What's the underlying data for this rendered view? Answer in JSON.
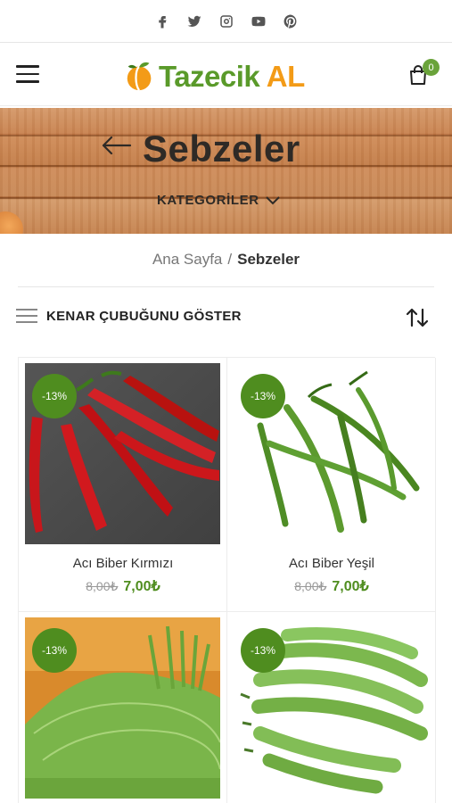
{
  "social": {
    "icons": [
      "facebook-icon",
      "twitter-icon",
      "instagram-icon",
      "youtube-icon",
      "pinterest-icon"
    ]
  },
  "header": {
    "logo_text_main": "Tazecik",
    "logo_text_accent": "AL",
    "cart_count": "0",
    "brand_green": "#5a9a2a",
    "brand_orange": "#f39b17"
  },
  "hero": {
    "title": "Sebzeler",
    "categories_label": "KATEGORİLER"
  },
  "breadcrumb": {
    "home": "Ana Sayfa",
    "separator": "/",
    "current": "Sebzeler"
  },
  "toolbar": {
    "sidebar_label": "KENAR ÇUBUĞUNU GÖSTER"
  },
  "products": [
    {
      "name": "Acı Biber Kırmızı",
      "old_price": "8,00₺",
      "price": "7,00₺",
      "badge": "-13%",
      "image": "red-chili-peppers"
    },
    {
      "name": "Acı Biber Yeşil",
      "old_price": "8,00₺",
      "price": "7,00₺",
      "badge": "-13%",
      "image": "green-chili-peppers"
    },
    {
      "name": "",
      "old_price": "",
      "price": "",
      "badge": "-13%",
      "image": "grape-leaves"
    },
    {
      "name": "",
      "old_price": "",
      "price": "",
      "badge": "-13%",
      "image": "green-broad-beans"
    }
  ]
}
